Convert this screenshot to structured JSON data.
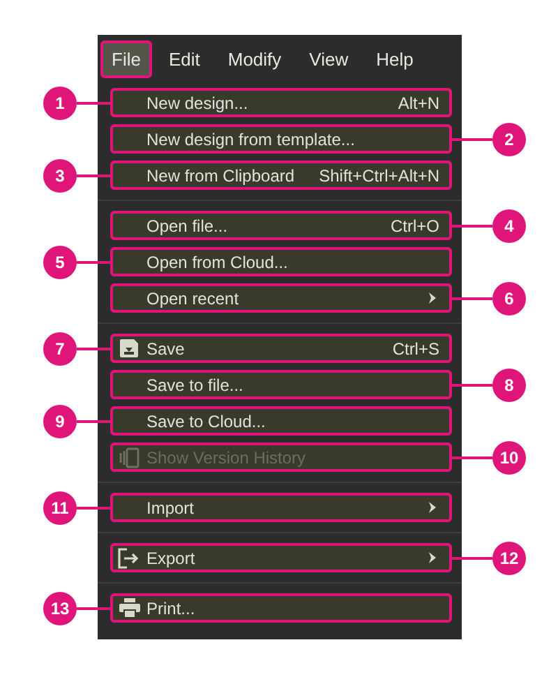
{
  "menubar": [
    {
      "label": "File",
      "selected": true
    },
    {
      "label": "Edit",
      "selected": false
    },
    {
      "label": "Modify",
      "selected": false
    },
    {
      "label": "View",
      "selected": false
    },
    {
      "label": "Help",
      "selected": false
    }
  ],
  "menu_groups": [
    [
      {
        "label": "New design...",
        "shortcut": "Alt+N",
        "callout": "1",
        "kind": "plain",
        "disabled": false,
        "submenu": false
      },
      {
        "label": "New design from template...",
        "callout": "2",
        "kind": "plain",
        "disabled": false,
        "submenu": false
      },
      {
        "label": "New from Clipboard",
        "shortcut": "Shift+Ctrl+Alt+N",
        "callout": "3",
        "kind": "plain",
        "disabled": false,
        "submenu": false
      }
    ],
    [
      {
        "label": "Open file...",
        "shortcut": "Ctrl+O",
        "callout": "4",
        "kind": "plain",
        "disabled": false,
        "submenu": false
      },
      {
        "label": "Open from Cloud...",
        "callout": "5",
        "kind": "plain",
        "disabled": false,
        "submenu": false
      },
      {
        "label": "Open recent",
        "callout": "6",
        "kind": "plain",
        "disabled": false,
        "submenu": true
      }
    ],
    [
      {
        "label": "Save",
        "shortcut": "Ctrl+S",
        "kind": "save",
        "callout": "7",
        "disabled": false,
        "submenu": false
      },
      {
        "label": "Save to file...",
        "callout": "8",
        "kind": "plain",
        "disabled": false,
        "submenu": false
      },
      {
        "label": "Save to Cloud...",
        "callout": "9",
        "kind": "plain",
        "disabled": false,
        "submenu": false
      },
      {
        "label": "Show Version History",
        "kind": "history",
        "callout": "10",
        "disabled": true,
        "submenu": false
      }
    ],
    [
      {
        "label": "Import",
        "callout": "11",
        "kind": "plain",
        "disabled": false,
        "submenu": true
      }
    ],
    [
      {
        "label": "Export",
        "kind": "export",
        "callout": "12",
        "disabled": false,
        "submenu": true
      }
    ],
    [
      {
        "label": "Print...",
        "kind": "print",
        "callout": "13",
        "disabled": false,
        "submenu": false
      }
    ]
  ]
}
